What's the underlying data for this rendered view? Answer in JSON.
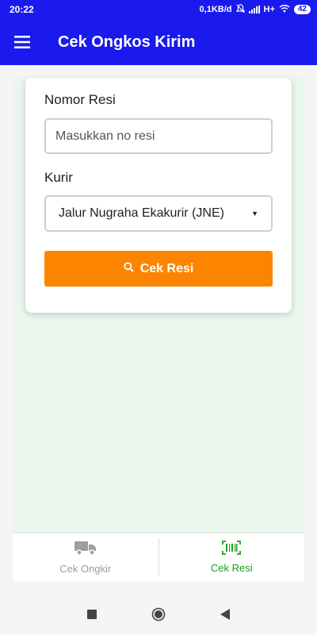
{
  "status_bar": {
    "time": "20:22",
    "network_speed": "0,1KB/d",
    "network_type": "H+",
    "battery": "42"
  },
  "app_bar": {
    "title": "Cek Ongkos Kirim",
    "menu_icon": "hamburger-menu-icon"
  },
  "form": {
    "resi_label": "Nomor Resi",
    "resi_value": "",
    "resi_placeholder": "Masukkan no resi",
    "kurir_label": "Kurir",
    "kurir_selected": "Jalur Nugraha Ekakurir (JNE)",
    "submit_label": "Cek Resi",
    "submit_icon": "search-icon"
  },
  "bottom_nav": {
    "items": [
      {
        "label": "Cek Ongkir",
        "icon": "truck-icon",
        "active": false
      },
      {
        "label": "Cek Resi",
        "icon": "barcode-icon",
        "active": true
      }
    ]
  },
  "colors": {
    "primary": "#1a1aee",
    "accent": "#fb8500",
    "active_tab": "#1aa01a",
    "content_bg": "#e8f6ee"
  }
}
